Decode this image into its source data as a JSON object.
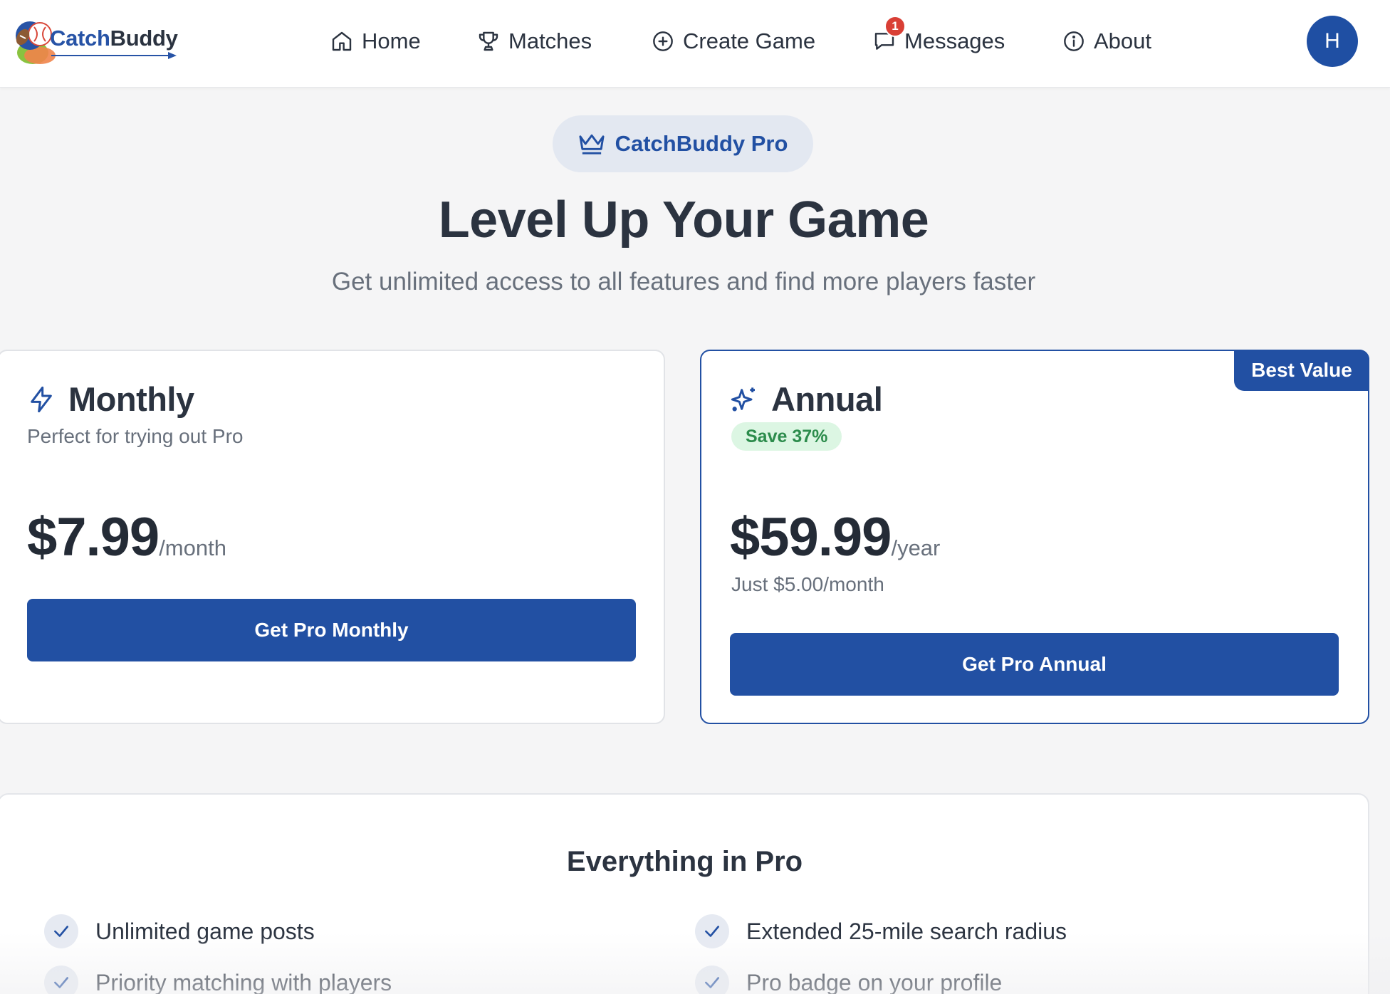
{
  "brand": {
    "name_part1": "Catch",
    "name_part2": "Buddy"
  },
  "nav": {
    "home": "Home",
    "matches": "Matches",
    "create_game": "Create Game",
    "messages": "Messages",
    "messages_unread": "1",
    "about": "About"
  },
  "user": {
    "avatar_initial": "H"
  },
  "hero": {
    "pill_label": "CatchBuddy Pro",
    "title": "Level Up Your Game",
    "subtitle": "Get unlimited access to all features and find more players faster"
  },
  "plans": {
    "monthly": {
      "name": "Monthly",
      "description": "Perfect for trying out Pro",
      "price": "$7.99",
      "period": "/month",
      "cta": "Get Pro Monthly"
    },
    "annual": {
      "ribbon": "Best Value",
      "name": "Annual",
      "save_tag": "Save 37%",
      "price": "$59.99",
      "period": "/year",
      "per_month_note": "Just $5.00/month",
      "cta": "Get Pro Annual"
    }
  },
  "features": {
    "title": "Everything in Pro",
    "items": [
      "Unlimited game posts",
      "Extended 25-mile search radius",
      "Priority matching with players",
      "Pro badge on your profile"
    ]
  },
  "colors": {
    "primary": "#2250a3",
    "badge_red": "#d93f35",
    "save_green": "#2c8c4c",
    "save_green_bg": "#dcf6e3"
  }
}
